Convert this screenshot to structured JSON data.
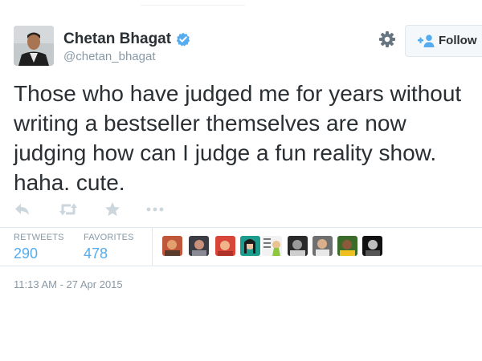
{
  "author": {
    "name": "Chetan Bhagat",
    "handle": "@chetan_bhagat",
    "verified": true
  },
  "header": {
    "follow_label": "Follow",
    "icons": [
      "verified-badge-icon",
      "gear-icon",
      "follow-person-plus-icon"
    ]
  },
  "tweet": {
    "text": "Those who have judged me for years without writing a bestseller themselves are now judging how can I judge a fun reality show. haha. cute.",
    "timestamp": "11:13 AM - 27 Apr 2015"
  },
  "actions": [
    "reply-icon",
    "retweet-icon",
    "favorite-star-icon",
    "more-icon"
  ],
  "stats": {
    "retweets_label": "RETWEETS",
    "retweets_value": "290",
    "favorites_label": "FAVORITES",
    "favorites_value": "478"
  },
  "favoriters": [
    "favoriter-avatar-1",
    "favoriter-avatar-2",
    "favoriter-avatar-3",
    "favoriter-avatar-4",
    "favoriter-avatar-5",
    "favoriter-avatar-6",
    "favoriter-avatar-7",
    "favoriter-avatar-8",
    "favoriter-avatar-9"
  ],
  "colors": {
    "text": "#292f33",
    "muted": "#8899a6",
    "link": "#55acee",
    "verified": "#55acee",
    "border": "#e1e8ed",
    "icon": "#ccd6dd"
  }
}
